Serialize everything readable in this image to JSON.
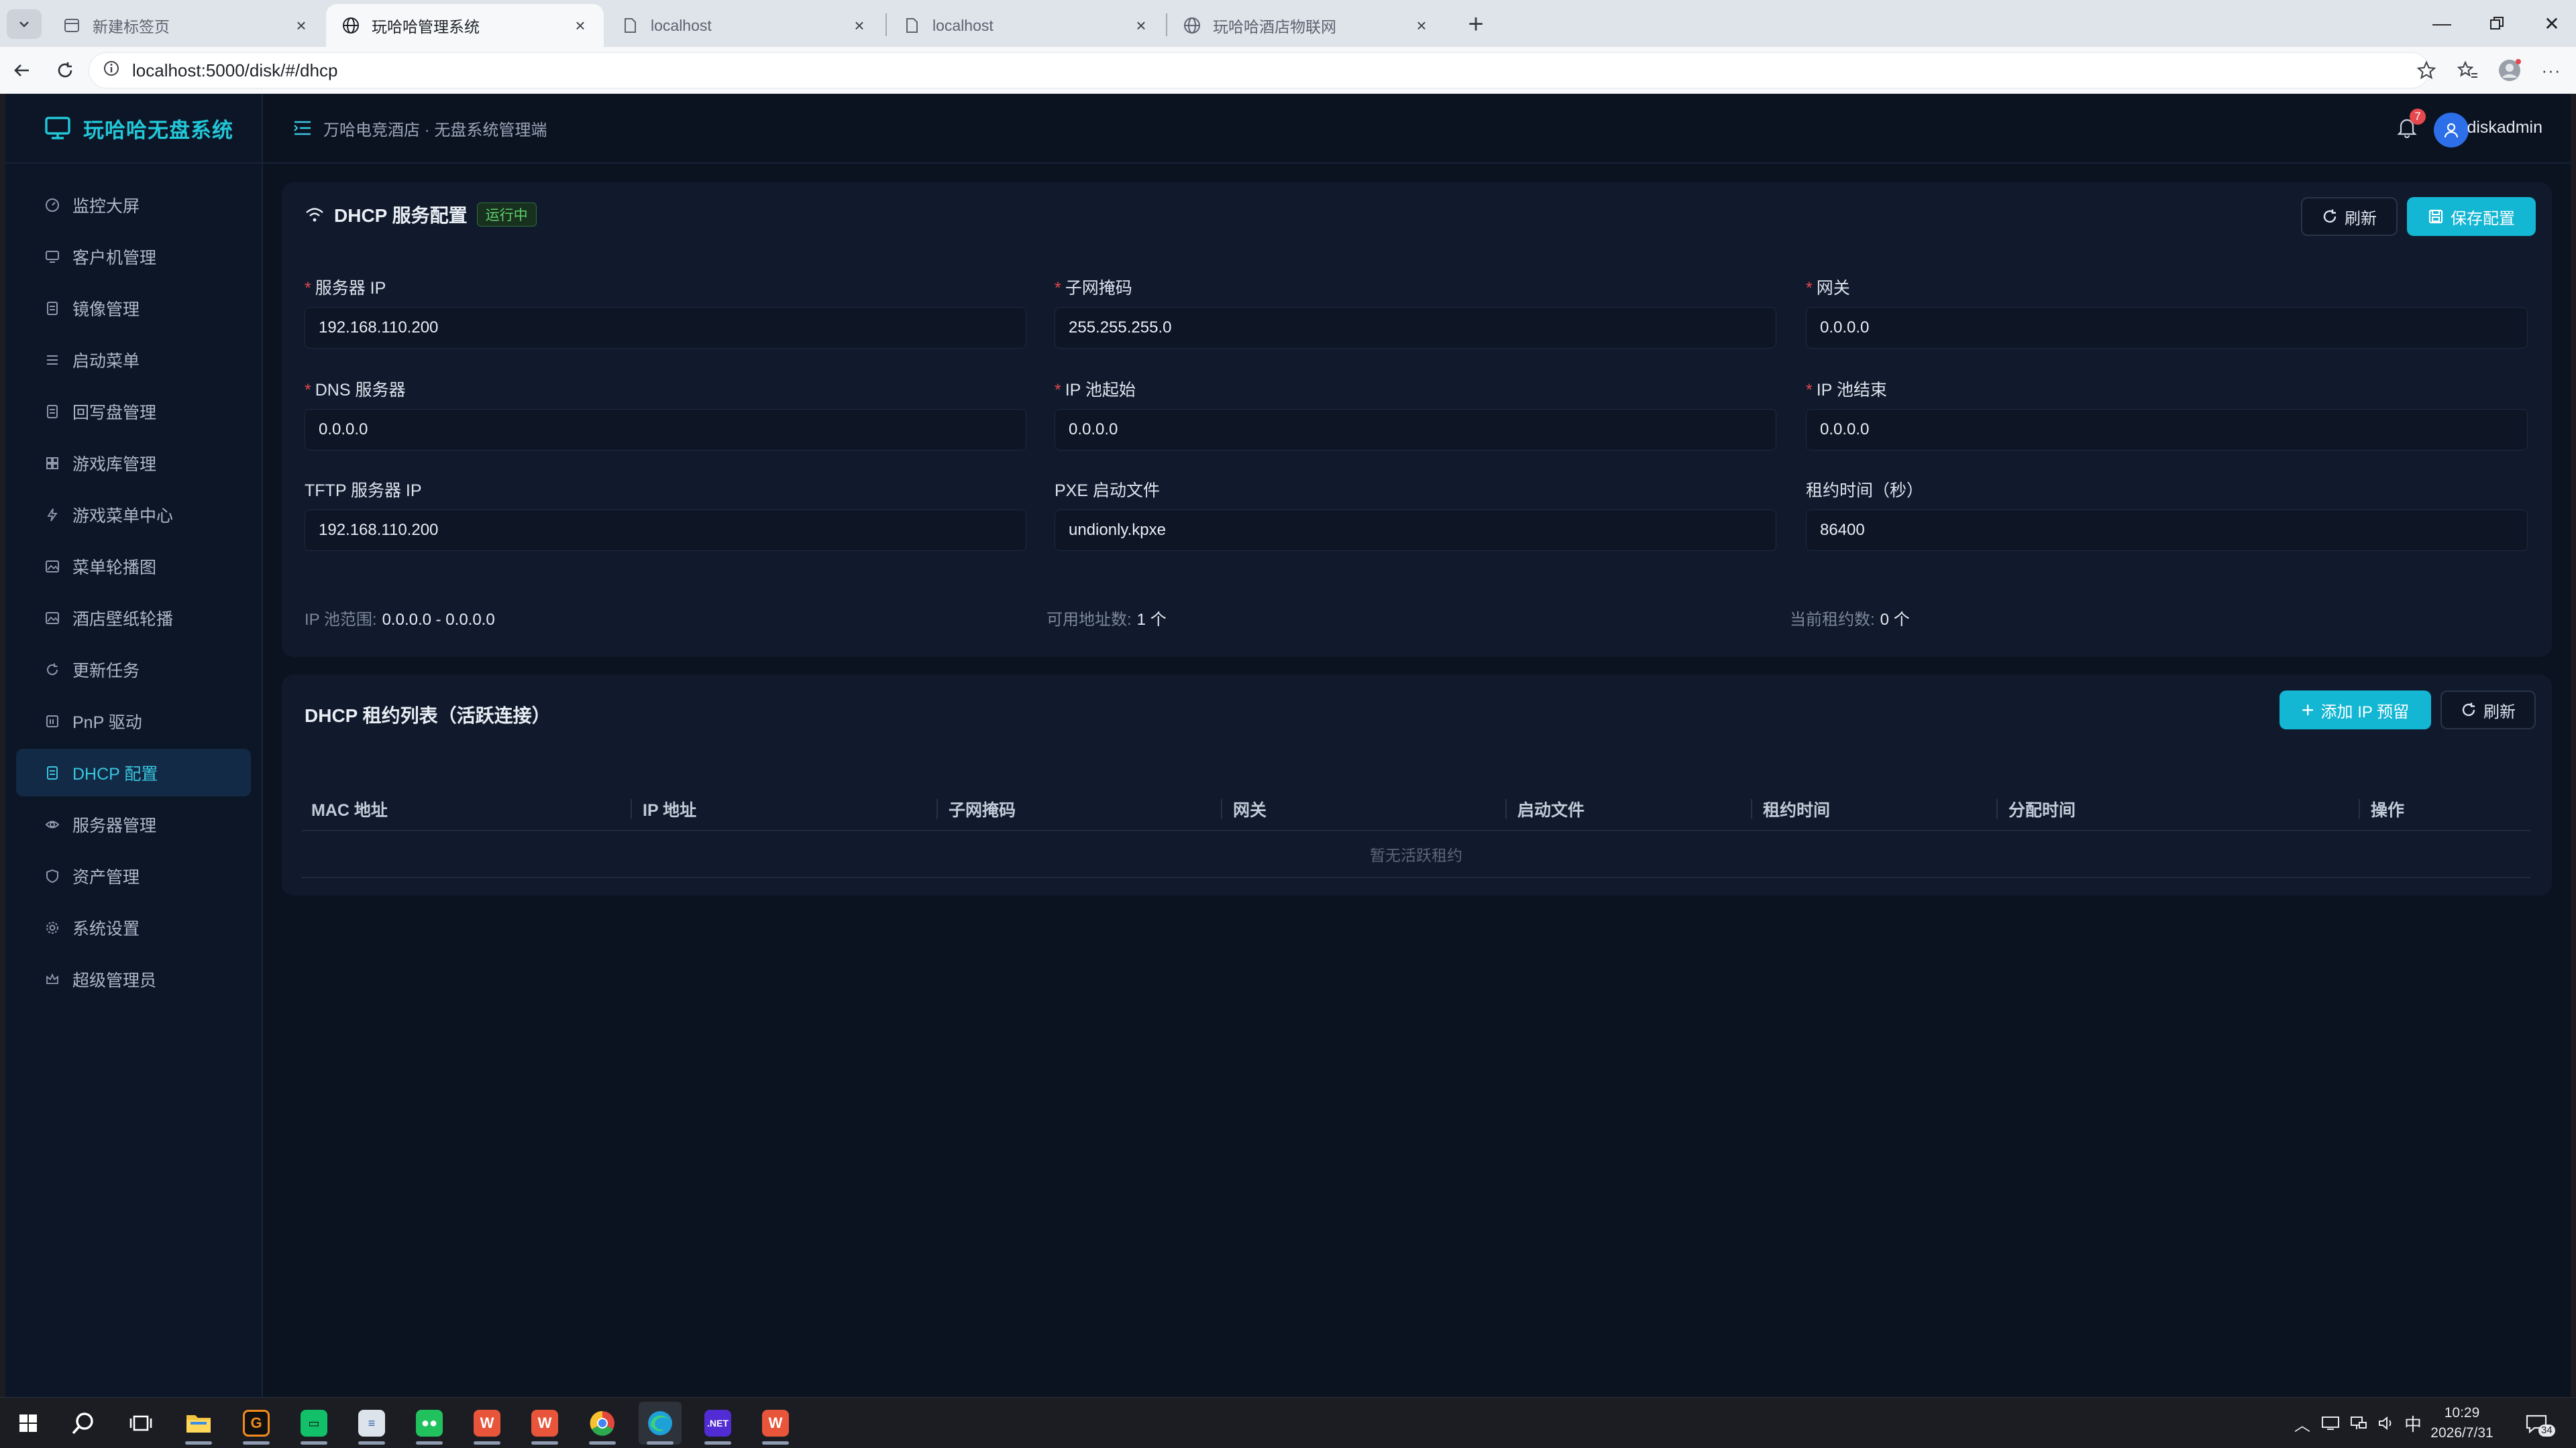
{
  "browser": {
    "tabs": [
      {
        "label": "新建标签页",
        "active": false
      },
      {
        "label": "玩哈哈管理系统",
        "active": true
      },
      {
        "label": "localhost",
        "active": false
      },
      {
        "label": "localhost",
        "active": false
      },
      {
        "label": "玩哈哈酒店物联网",
        "active": false
      }
    ],
    "url": "localhost:5000/disk/#/dhcp"
  },
  "app": {
    "brand": "玩哈哈无盘系统",
    "breadcrumb": "万哈电竞酒店 · 无盘系统管理端",
    "notification_count": "7",
    "username": "diskadmin",
    "accent_color": "#13b6d3"
  },
  "sidebar": {
    "items": [
      {
        "label": "监控大屏",
        "icon": "dashboard-icon"
      },
      {
        "label": "客户机管理",
        "icon": "monitor-icon"
      },
      {
        "label": "镜像管理",
        "icon": "document-icon"
      },
      {
        "label": "启动菜单",
        "icon": "list-icon"
      },
      {
        "label": "回写盘管理",
        "icon": "document-icon"
      },
      {
        "label": "游戏库管理",
        "icon": "grid-icon"
      },
      {
        "label": "游戏菜单中心",
        "icon": "lightning-icon"
      },
      {
        "label": "菜单轮播图",
        "icon": "picture-icon"
      },
      {
        "label": "酒店壁纸轮播",
        "icon": "picture-icon"
      },
      {
        "label": "更新任务",
        "icon": "refresh-icon"
      },
      {
        "label": "PnP 驱动",
        "icon": "chip-icon"
      },
      {
        "label": "DHCP 配置",
        "icon": "document-icon",
        "active": true
      },
      {
        "label": "服务器管理",
        "icon": "eye-icon"
      },
      {
        "label": "资产管理",
        "icon": "shield-icon"
      },
      {
        "label": "系统设置",
        "icon": "gear-icon"
      },
      {
        "label": "超级管理员",
        "icon": "crown-icon"
      }
    ]
  },
  "dhcp_config": {
    "title": "DHCP 服务配置",
    "status": "运行中",
    "refresh_label": "刷新",
    "save_label": "保存配置",
    "fields": [
      {
        "label": "服务器 IP",
        "value": "192.168.110.200",
        "required": true
      },
      {
        "label": "子网掩码",
        "value": "255.255.255.0",
        "required": true
      },
      {
        "label": "网关",
        "value": "0.0.0.0",
        "required": true
      },
      {
        "label": "DNS 服务器",
        "value": "0.0.0.0",
        "required": true
      },
      {
        "label": "IP 池起始",
        "value": "0.0.0.0",
        "required": true
      },
      {
        "label": "IP 池结束",
        "value": "0.0.0.0",
        "required": true
      },
      {
        "label": "TFTP 服务器 IP",
        "value": "192.168.110.200",
        "required": false
      },
      {
        "label": "PXE 启动文件",
        "value": "undionly.kpxe",
        "required": false
      },
      {
        "label": "租约时间（秒）",
        "value": "86400",
        "required": false
      }
    ],
    "summary": {
      "pool_range_label": "IP 池范围:",
      "pool_range_value": "0.0.0.0 - 0.0.0.0",
      "available_label": "可用地址数:",
      "available_value": "1 个",
      "leases_label": "当前租约数:",
      "leases_value": "0 个"
    }
  },
  "lease_table": {
    "title": "DHCP 租约列表（活跃连接）",
    "add_label": "添加 IP 预留",
    "refresh_label": "刷新",
    "columns": [
      "MAC 地址",
      "IP 地址",
      "子网掩码",
      "网关",
      "启动文件",
      "租约时间",
      "分配时间",
      "操作"
    ],
    "empty_text": "暂无活跃租约"
  },
  "taskbar": {
    "ime": "中",
    "time": "10:29",
    "date": "2026/7/31",
    "notif_count": "34"
  }
}
